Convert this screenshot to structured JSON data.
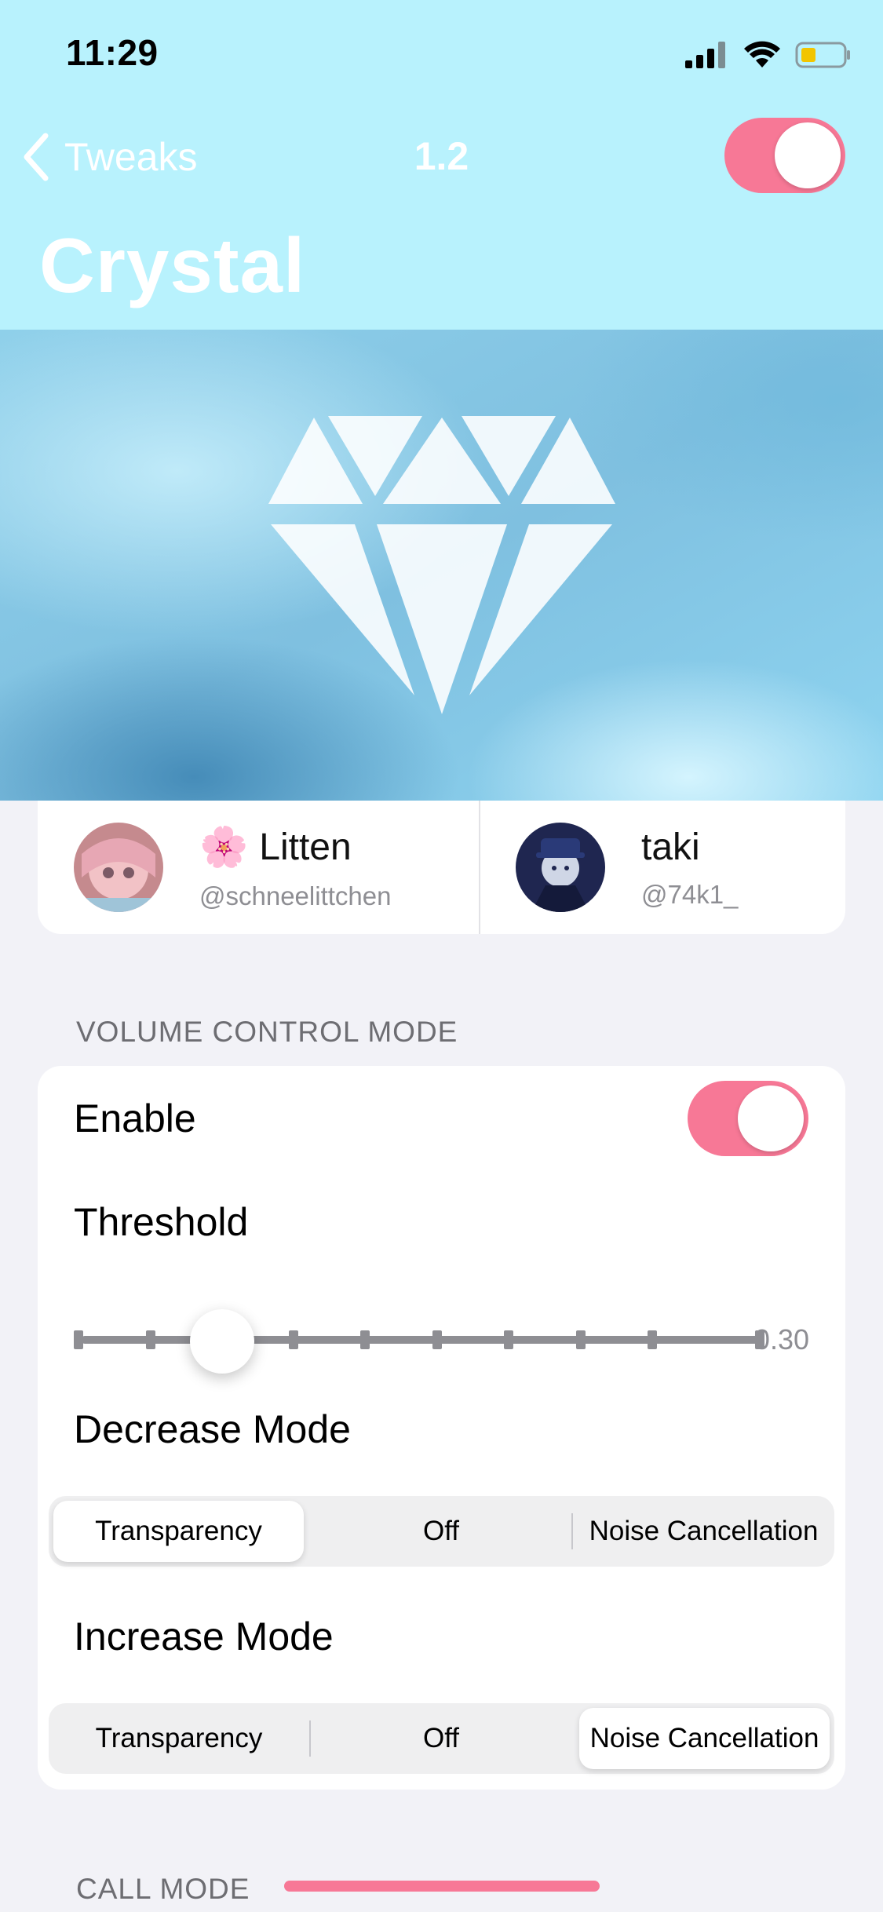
{
  "status_bar": {
    "time": "11:29",
    "battery_color": "#f2c500"
  },
  "nav": {
    "back_label": "Tweaks",
    "version": "1.2",
    "master_switch_on": true
  },
  "title": "Crystal",
  "colors": {
    "header_bg": "#b8f2fd",
    "accent": "#f77896",
    "page_bg": "#f2f2f7"
  },
  "banner": {
    "icon": "diamond-icon"
  },
  "authors": [
    {
      "emoji": "🌸",
      "name": "Litten",
      "handle": "@schneelittchen"
    },
    {
      "emoji": "",
      "name": "taki",
      "handle": "@74k1_"
    }
  ],
  "volume_section": {
    "header": "VOLUME CONTROL MODE",
    "enable_label": "Enable",
    "enable_on": true,
    "threshold_label": "Threshold",
    "threshold_value": "0.30",
    "threshold_fraction": 0.2,
    "decrease_label": "Decrease Mode",
    "decrease_options": [
      "Transparency",
      "Off",
      "Noise Cancellation"
    ],
    "decrease_selected": "Transparency",
    "increase_label": "Increase Mode",
    "increase_options": [
      "Transparency",
      "Off",
      "Noise Cancellation"
    ],
    "increase_selected": "Noise Cancellation"
  },
  "call_section": {
    "header": "CALL MODE"
  }
}
